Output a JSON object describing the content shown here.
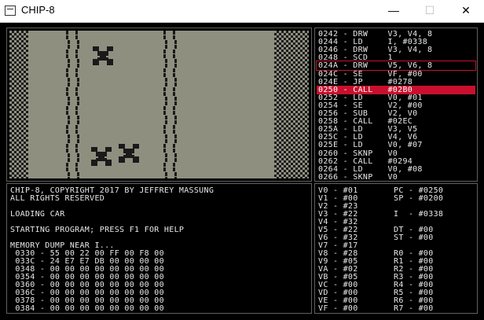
{
  "window": {
    "title": "CHIP-8",
    "minimize": "—",
    "maximize": "☐",
    "close": "✕"
  },
  "disassembly": [
    {
      "text": "0242 - DRW    V3, V4, 8",
      "state": ""
    },
    {
      "text": "0244 - LD     I, #0338",
      "state": ""
    },
    {
      "text": "0246 - DRW    V3, V4, 8",
      "state": ""
    },
    {
      "text": "0248 - SCD    1",
      "state": ""
    },
    {
      "text": "024A - DRW    V5, V6, 8",
      "state": "breakpoint"
    },
    {
      "text": "024C - SE     VF, #00",
      "state": ""
    },
    {
      "text": "024E - JP     #0278",
      "state": ""
    },
    {
      "text": "0250 - CALL   #02B0",
      "state": "current"
    },
    {
      "text": "0252 - LD     V0, #01",
      "state": ""
    },
    {
      "text": "0254 - SE     V2, #00",
      "state": ""
    },
    {
      "text": "0256 - SUB    V2, V0",
      "state": ""
    },
    {
      "text": "0258 - CALL   #02EC",
      "state": ""
    },
    {
      "text": "025A - LD     V3, V5",
      "state": ""
    },
    {
      "text": "025C - LD     V4, V6",
      "state": ""
    },
    {
      "text": "025E - LD     V0, #07",
      "state": ""
    },
    {
      "text": "0260 - SKNP   V0",
      "state": ""
    },
    {
      "text": "0262 - CALL   #0294",
      "state": ""
    },
    {
      "text": "0264 - LD     V0, #08",
      "state": ""
    },
    {
      "text": "0266 - SKNP   V0",
      "state": ""
    }
  ],
  "console": [
    "CHIP-8, COPYRIGHT 2017 BY JEFFREY MASSUNG",
    "ALL RIGHTS RESERVED",
    "",
    "LOADING CAR",
    "",
    "STARTING PROGRAM; PRESS F1 FOR HELP",
    "",
    "MEMORY DUMP NEAR I...",
    " 0330 - 55 00 22 00 FF 00 F8 00",
    " 033C - 24 E7 E7 DB 00 00 00 00",
    " 0348 - 00 00 00 00 00 00 00 00",
    " 0354 - 00 00 00 00 00 00 00 00",
    " 0360 - 00 00 00 00 00 00 00 00",
    " 036C - 00 00 00 00 00 00 00 00",
    " 0378 - 00 00 00 00 00 00 00 00",
    " 0384 - 00 00 00 00 00 00 00 00"
  ],
  "registers": [
    {
      "left": "V0 - #01",
      "right": "PC - #0250"
    },
    {
      "left": "V1 - #00",
      "right": "SP - #0200"
    },
    {
      "left": "V2 - #23",
      "right": ""
    },
    {
      "left": "V3 - #22",
      "right": "I  - #0338"
    },
    {
      "left": "V4 - #32",
      "right": ""
    },
    {
      "left": "V5 - #22",
      "right": "DT - #00"
    },
    {
      "left": "V6 - #32",
      "right": "ST - #00"
    },
    {
      "left": "V7 - #17",
      "right": ""
    },
    {
      "left": "V8 - #28",
      "right": "R0 - #00"
    },
    {
      "left": "V9 - #05",
      "right": "R1 - #00"
    },
    {
      "left": "VA - #02",
      "right": "R2 - #00"
    },
    {
      "left": "VB - #05",
      "right": "R3 - #00"
    },
    {
      "left": "VC - #00",
      "right": "R4 - #00"
    },
    {
      "left": "VD - #00",
      "right": "R5 - #00"
    },
    {
      "left": "VE - #00",
      "right": "R6 - #00"
    },
    {
      "left": "VF - #00",
      "right": "R7 - #00"
    }
  ],
  "colors": {
    "screen_bg": "#8f8f80",
    "pixel": "#1a1a1a",
    "highlight": "#c8102e",
    "text": "#e8e8e8"
  }
}
